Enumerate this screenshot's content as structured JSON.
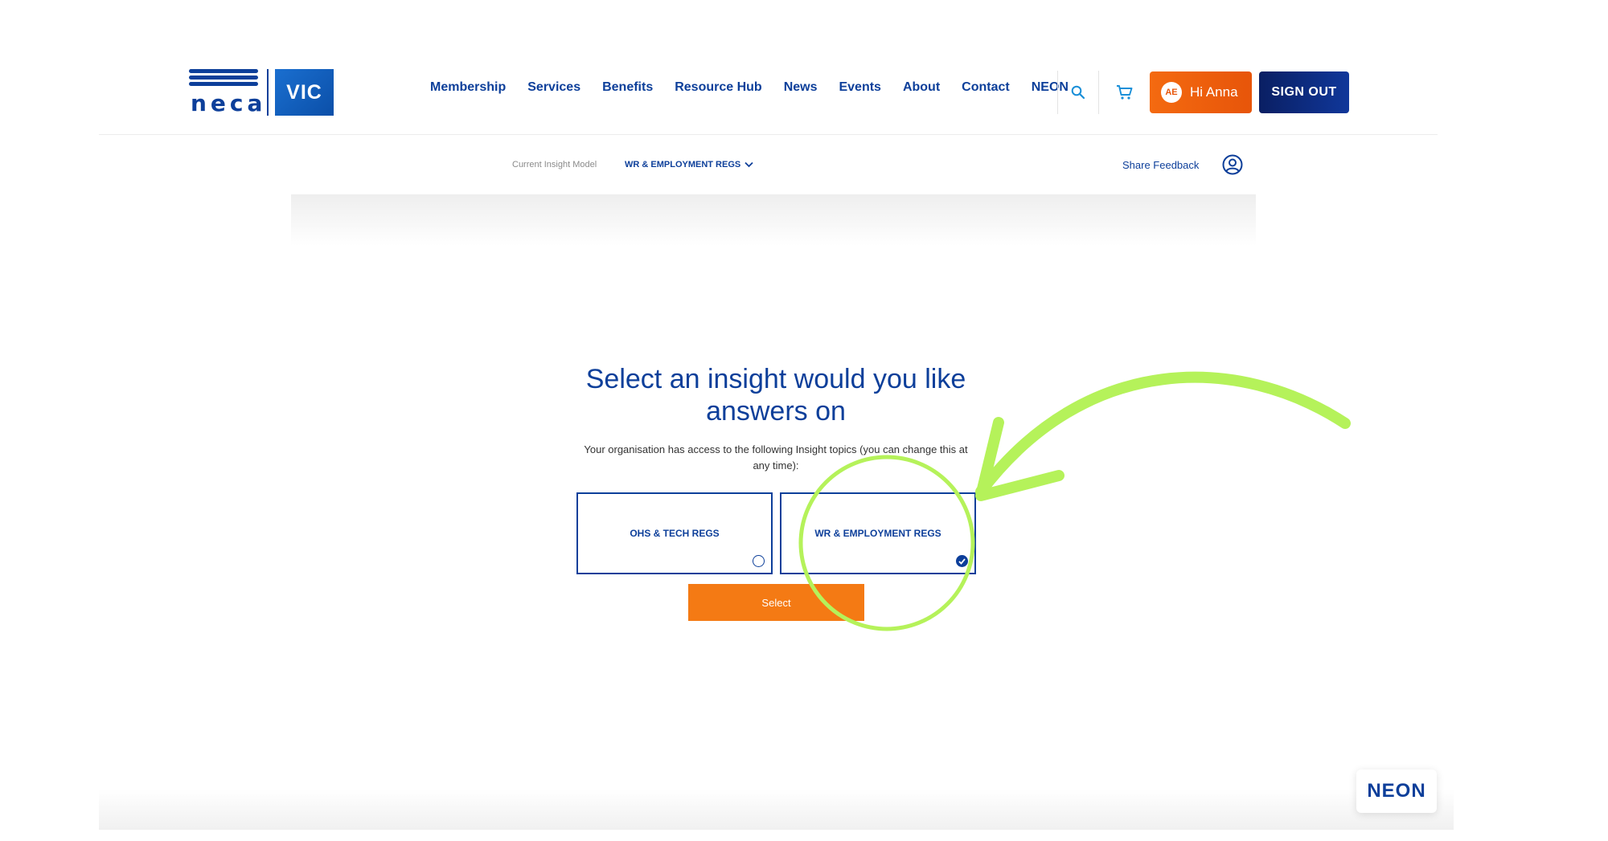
{
  "header": {
    "logo": {
      "word": "neca",
      "region": "VIC"
    },
    "nav": [
      "Membership",
      "Services",
      "Benefits",
      "Resource Hub",
      "News",
      "Events",
      "About",
      "Contact",
      "NEON"
    ],
    "icons": {
      "search": "search-icon",
      "cart": "cart-icon"
    },
    "user_button": {
      "initials": "AE",
      "label": "Hi Anna"
    },
    "signout_label": "SIGN OUT"
  },
  "subbar": {
    "current_label": "Current Insight Model",
    "current_model": "WR & EMPLOYMENT REGS",
    "share_feedback": "Share Feedback"
  },
  "main": {
    "title": "Select an insight would you like answers on",
    "subtitle": "Your organisation has access to the following Insight topics (you can change this at any time):",
    "options": [
      {
        "label": "OHS & TECH REGS",
        "selected": false
      },
      {
        "label": "WR & EMPLOYMENT REGS",
        "selected": true
      }
    ],
    "select_label": "Select"
  },
  "badge": {
    "text": "NEON"
  },
  "colors": {
    "brand_blue": "#0d3f9a",
    "orange": "#f47a14",
    "annotation_green": "#b5f25a"
  }
}
